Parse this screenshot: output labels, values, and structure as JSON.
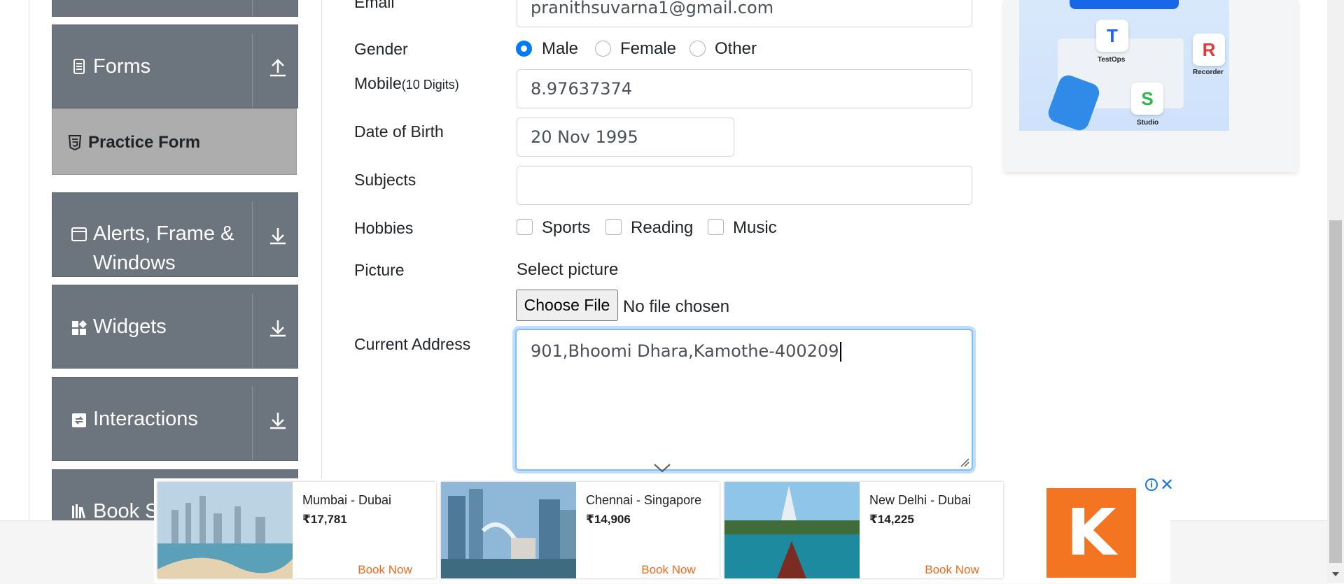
{
  "sidebar": {
    "groups": [
      {
        "label": "Forms",
        "icon": "form-icon",
        "arrow": "upload-arrow-icon"
      },
      {
        "label": "Alerts, Frame &",
        "label2": "Windows",
        "icon": "window-icon",
        "arrow": "download-arrow-icon"
      },
      {
        "label": "Widgets",
        "icon": "widgets-icon",
        "arrow": "download-arrow-icon"
      },
      {
        "label": "Interactions",
        "icon": "interactions-icon",
        "arrow": "download-arrow-icon"
      },
      {
        "label": "Book S",
        "icon": "books-icon"
      }
    ],
    "active_item": {
      "label": "Practice Form",
      "icon": "html5-icon"
    }
  },
  "form": {
    "email": {
      "label": "Email",
      "value": "pranithsuvarna1@gmail.com"
    },
    "gender": {
      "label": "Gender",
      "options": [
        "Male",
        "Female",
        "Other"
      ],
      "selected": "Male"
    },
    "mobile": {
      "label": "Mobile",
      "hint": "(10 Digits)",
      "value": "8.97637374"
    },
    "dob": {
      "label": "Date of Birth",
      "value": "20 Nov 1995"
    },
    "subjects": {
      "label": "Subjects",
      "value": ""
    },
    "hobbies": {
      "label": "Hobbies",
      "options": [
        "Sports",
        "Reading",
        "Music"
      ]
    },
    "picture": {
      "label": "Picture",
      "select_text": "Select picture",
      "button": "Choose File",
      "status": "No file chosen"
    },
    "address": {
      "label": "Current Address",
      "value": "901,Bhoomi Dhara,Kamothe-400209"
    }
  },
  "side_ad": {
    "labels": [
      "TestOps",
      "Recorder",
      "Studio"
    ]
  },
  "bottom_ad": {
    "cards": [
      {
        "route": "Mumbai - Dubai",
        "price": "₹17,781",
        "cta": "Book Now"
      },
      {
        "route": "Chennai - Singapore",
        "price": "₹14,906",
        "cta": "Book Now"
      },
      {
        "route": "New Delhi - Dubai",
        "price": "₹14,225",
        "cta": "Book Now"
      }
    ],
    "logo_letter": "K",
    "info": "i",
    "close": "✕"
  },
  "colors": {
    "sidebar_bg": "#6c757d",
    "active_bg": "#adadad",
    "radio_accent": "#007bff",
    "focus_border": "#80bdff",
    "cta": "#f06a1a",
    "logo_bg": "#f47521"
  }
}
